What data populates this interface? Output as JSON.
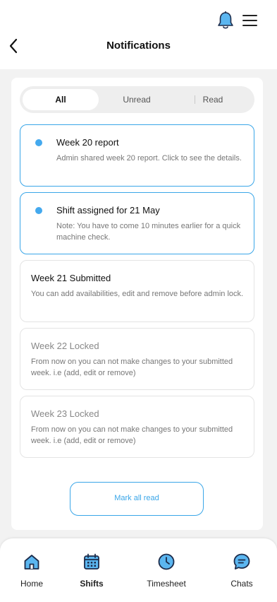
{
  "header": {
    "title": "Notifications",
    "icons": {
      "back": "chevron-left-icon",
      "bell": "bell-icon",
      "menu": "hamburger-menu-icon"
    }
  },
  "tabs": [
    {
      "label": "All",
      "active": true
    },
    {
      "label": "Unread",
      "active": false
    },
    {
      "label": "Read",
      "active": false
    }
  ],
  "notifications": [
    {
      "title": "Week 20 report",
      "body": "Admin shared week 20 report. Click to see the details.",
      "unread": true
    },
    {
      "title": "Shift assigned for 21 May",
      "body": "Note: You have to come 10 minutes earlier for a quick machine check.",
      "unread": true
    },
    {
      "title": "Week 21 Submitted",
      "body": "You can add availabilities, edit and remove before admin lock.",
      "unread": false
    },
    {
      "title": "Week 22 Locked",
      "body": "From now on you can not make changes to your submitted week. i.e (add, edit or remove)",
      "unread": false
    },
    {
      "title": "Week 23 Locked",
      "body": "From now on you can not make changes to your submitted week. i.e (add, edit or remove)",
      "unread": false
    }
  ],
  "actions": {
    "mark_all_read": "Mark all read"
  },
  "bottom_nav": [
    {
      "label": "Home",
      "icon": "home-icon",
      "active": false
    },
    {
      "label": "Shifts",
      "icon": "calendar-icon",
      "active": true
    },
    {
      "label": "Timesheet",
      "icon": "clock-icon",
      "active": false
    },
    {
      "label": "Chats",
      "icon": "chat-bubble-icon",
      "active": false
    }
  ],
  "colors": {
    "accent": "#3AA6E8",
    "unread_dot": "#44A9EE",
    "icon_fill": "#5BB6F0",
    "icon_stroke": "#1C2B4A"
  }
}
